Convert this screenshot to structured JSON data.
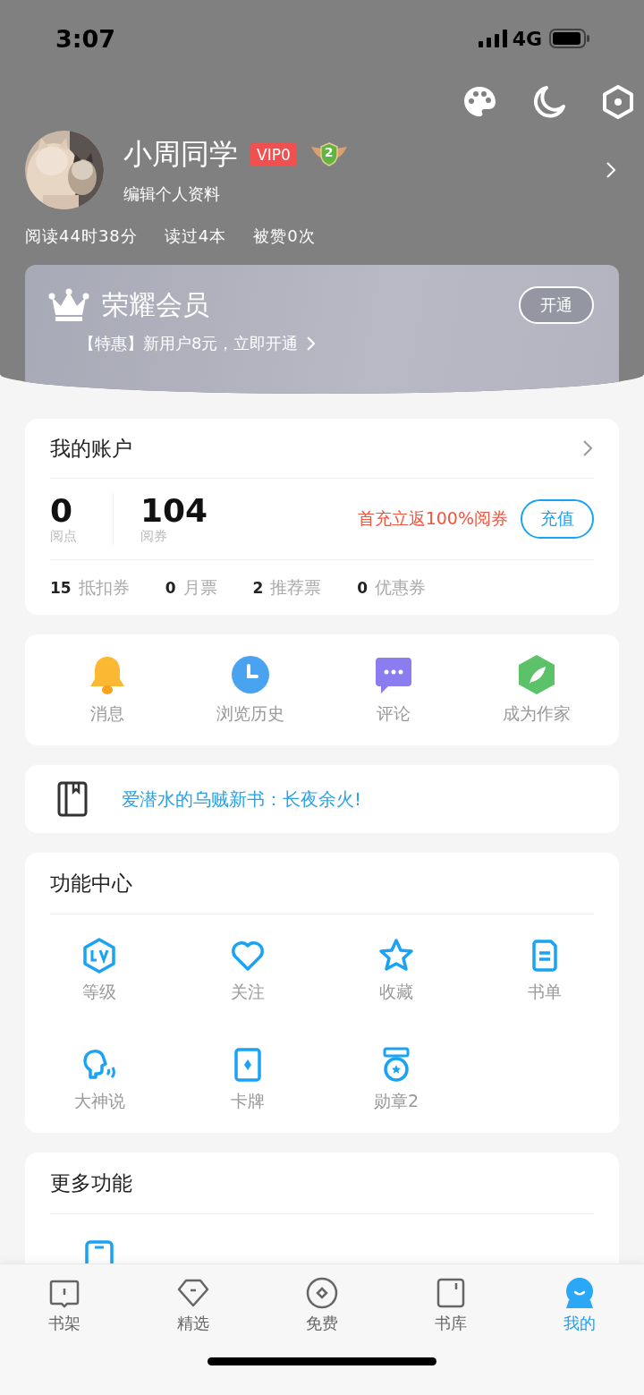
{
  "status_bar": {
    "time": "3:07",
    "network": "4G"
  },
  "profile": {
    "name": "小周同学",
    "vip_badge": "VIP0",
    "level_badge": "2",
    "edit_link": "编辑个人资料",
    "stats": [
      "阅读44时38分",
      "读过4本",
      "被赞0次"
    ]
  },
  "membership": {
    "title": "荣耀会员",
    "button": "开通",
    "promo": "【特惠】新用户8元，立即开通"
  },
  "account": {
    "title": "我的账户",
    "balances": [
      {
        "value": "0",
        "label": "阅点"
      },
      {
        "value": "104",
        "label": "阅券"
      }
    ],
    "promo": "首充立返100%阅券",
    "button": "充值",
    "tickets": [
      {
        "count": "15",
        "label": "抵扣券"
      },
      {
        "count": "0",
        "label": "月票"
      },
      {
        "count": "2",
        "label": "推荐票"
      },
      {
        "count": "0",
        "label": "优惠券"
      }
    ]
  },
  "shortcuts": [
    {
      "label": "消息"
    },
    {
      "label": "浏览历史"
    },
    {
      "label": "评论"
    },
    {
      "label": "成为作家"
    }
  ],
  "notice": {
    "text": "爱潜水的乌贼新书：长夜余火!"
  },
  "function_center": {
    "title": "功能中心",
    "items": [
      {
        "label": "等级"
      },
      {
        "label": "关注"
      },
      {
        "label": "收藏"
      },
      {
        "label": "书单"
      },
      {
        "label": "大神说"
      },
      {
        "label": "卡牌"
      },
      {
        "label": "勋章2"
      }
    ]
  },
  "more_functions": {
    "title": "更多功能"
  },
  "tab_bar": [
    {
      "label": "书架",
      "selected": false
    },
    {
      "label": "精选",
      "selected": false
    },
    {
      "label": "免费",
      "selected": false
    },
    {
      "label": "书库",
      "selected": false
    },
    {
      "label": "我的",
      "selected": true
    }
  ]
}
